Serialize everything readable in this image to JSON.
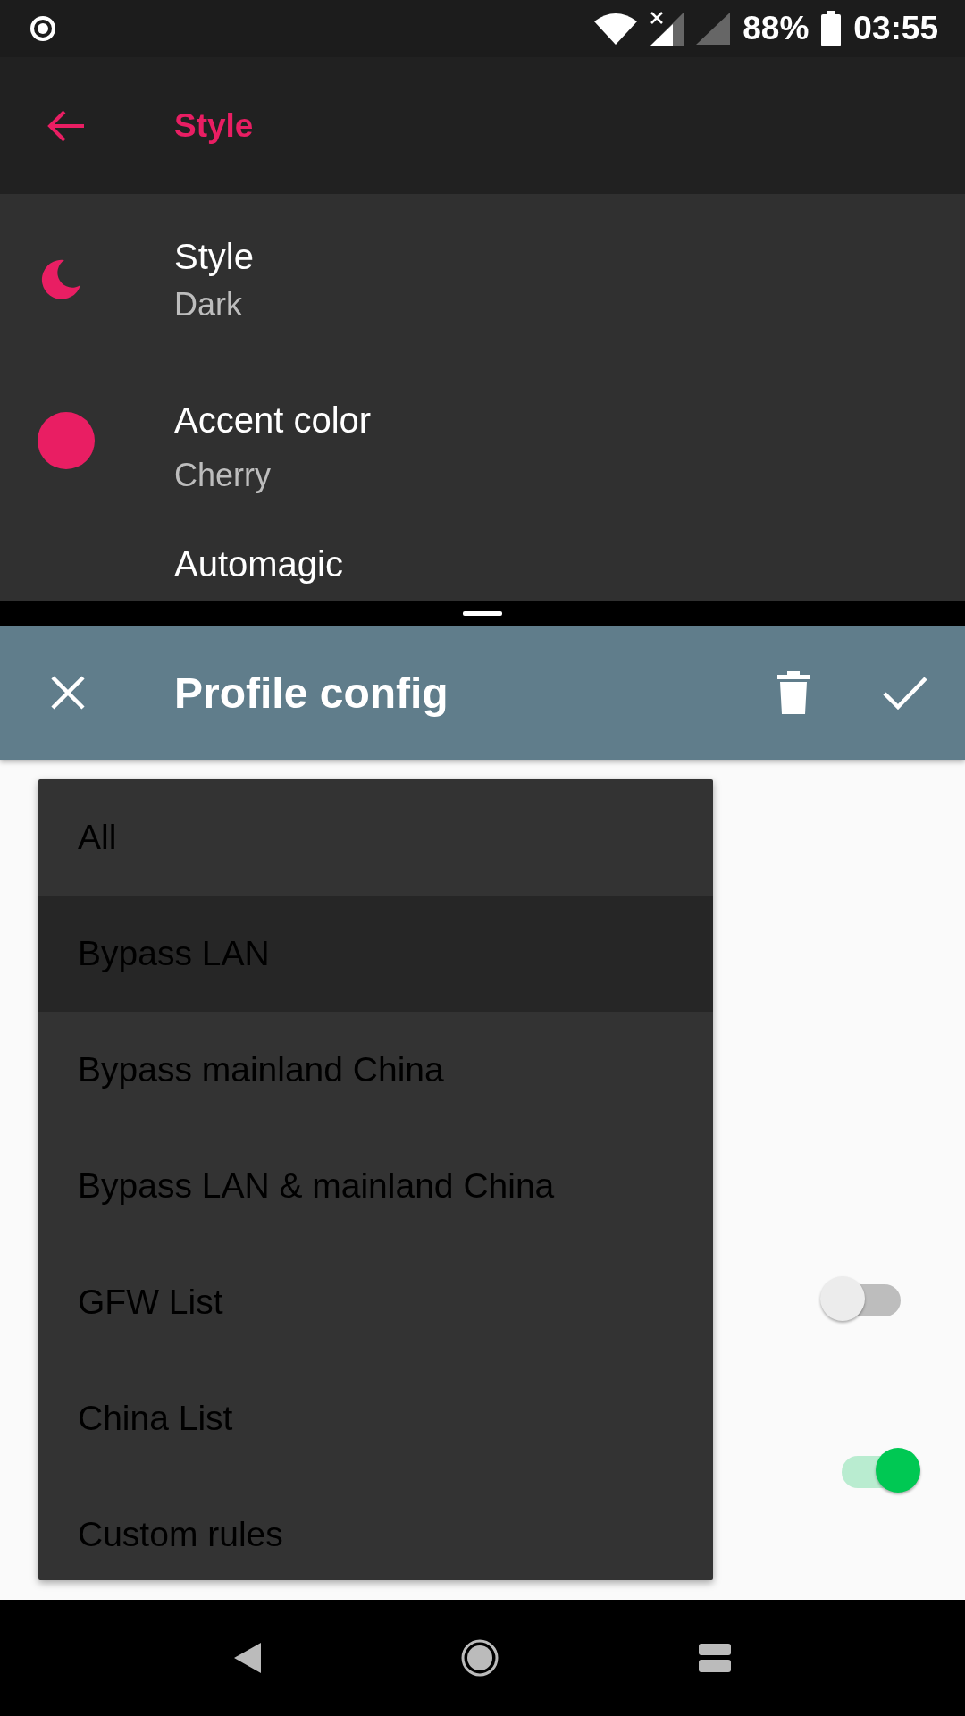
{
  "status_bar": {
    "battery": "88%",
    "time": "03:55"
  },
  "top_app": {
    "title": "Style",
    "settings": [
      {
        "kind": "moon",
        "title": "Style",
        "subtitle": "Dark"
      },
      {
        "kind": "dot",
        "title": "Accent color",
        "subtitle": "Cherry",
        "color": "#e91e63"
      },
      {
        "kind": "none",
        "title": "Automagic"
      }
    ]
  },
  "bottom_app": {
    "title": "Profile config",
    "menu": [
      {
        "label": "All",
        "selected": false
      },
      {
        "label": "Bypass LAN",
        "selected": true
      },
      {
        "label": "Bypass mainland China",
        "selected": false
      },
      {
        "label": "Bypass LAN & mainland China",
        "selected": false
      },
      {
        "label": "GFW List",
        "selected": false
      },
      {
        "label": "China List",
        "selected": false
      },
      {
        "label": "Custom rules",
        "selected": false
      }
    ],
    "switches": [
      {
        "on": false
      },
      {
        "on": true
      }
    ]
  }
}
